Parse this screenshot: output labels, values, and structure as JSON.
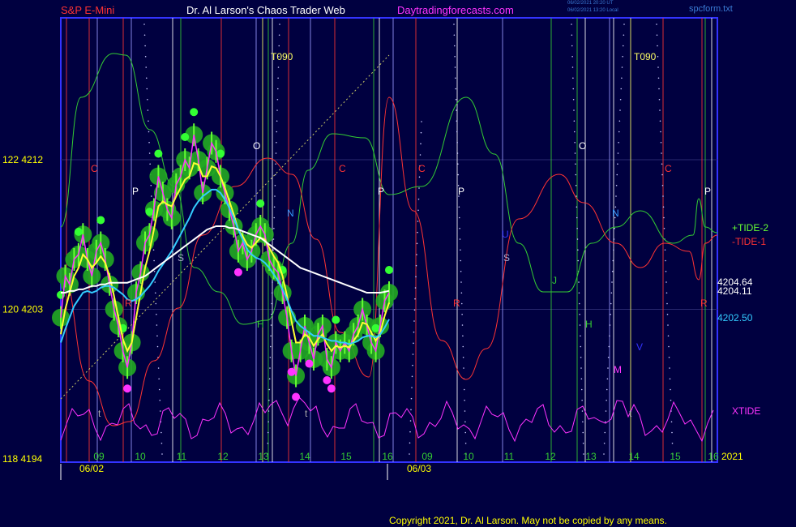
{
  "header": {
    "symbol": "S&P E-Mini",
    "site": "Dr. Al Larson's Chaos Trader Web",
    "url": "Daytradingforecasts.com",
    "stamp1": "06/02/2021 20:20 UT",
    "stamp2": "06/02/2021 13:20 Local",
    "file": "spcform.txt"
  },
  "footer": {
    "copyright": "Copyright 2021, Dr. Al Larson. May not be copied by any means."
  },
  "chart_data": {
    "type": "line",
    "y_left_labels": [
      "118 4194",
      "120 4203",
      "122 4212"
    ],
    "y_left_values": [
      4194,
      4203,
      4212
    ],
    "ylim": [
      4194,
      4212
    ],
    "hour_labels": [
      "09",
      "10",
      "11",
      "12",
      "13",
      "14",
      "15",
      "16",
      "09",
      "10",
      "11",
      "12",
      "13",
      "14",
      "15",
      "16"
    ],
    "date_labels": [
      "06/02",
      "06/03"
    ],
    "year_label": "2021",
    "right_labels": [
      {
        "text": "+TIDE-2",
        "color": "#66ff33"
      },
      {
        "text": "-TIDE-1",
        "color": "#ff3333"
      },
      {
        "text": "4204.64",
        "color": "#ffffff"
      },
      {
        "text": "4204.11",
        "color": "#ffffff"
      },
      {
        "text": "4202.50",
        "color": "#33ccff"
      },
      {
        "text": "XTIDE",
        "color": "#ff33ff"
      }
    ],
    "marker_letters": [
      {
        "text": "T090",
        "color": "#ffff66"
      },
      {
        "text": "T090",
        "color": "#ffff66"
      },
      {
        "text": "C",
        "color": "#ff3333"
      },
      {
        "text": "C",
        "color": "#ff3333"
      },
      {
        "text": "C",
        "color": "#ff3333"
      },
      {
        "text": "C",
        "color": "#ff3333"
      },
      {
        "text": "P",
        "color": "#ffffff"
      },
      {
        "text": "P",
        "color": "#ffffff"
      },
      {
        "text": "P",
        "color": "#ffffff"
      },
      {
        "text": "P",
        "color": "#ffffff"
      },
      {
        "text": "O",
        "color": "#ffffff"
      },
      {
        "text": "O",
        "color": "#ffffff"
      },
      {
        "text": "N",
        "color": "#3399ff"
      },
      {
        "text": "N",
        "color": "#3399ff"
      },
      {
        "text": "S",
        "color": "#aaaacc"
      },
      {
        "text": "S",
        "color": "#aaaacc"
      },
      {
        "text": "H",
        "color": "#33cc33"
      },
      {
        "text": "H",
        "color": "#33cc33"
      },
      {
        "text": "R",
        "color": "#ff3333"
      },
      {
        "text": "R",
        "color": "#ff3333"
      },
      {
        "text": "R",
        "color": "#ff3333"
      },
      {
        "text": "J",
        "color": "#33cc33"
      },
      {
        "text": "U",
        "color": "#3333ff"
      },
      {
        "text": "V",
        "color": "#3333ff"
      },
      {
        "text": "M",
        "color": "#ff33ff"
      },
      {
        "text": "t",
        "color": "#aaaaaa"
      },
      {
        "text": "t",
        "color": "#aaaaaa"
      },
      {
        "text": "t",
        "color": "#aaaaaa"
      }
    ],
    "series": [
      {
        "name": "",
        "color": "#ff33ff",
        "values": [
          4202.5,
          4205.0,
          4204.5,
          4206.0,
          4206.3,
          4207.5,
          4206.0,
          4205.0,
          4206.5,
          4207.0,
          4206.0,
          4204.5,
          4203.0,
          4202.0,
          4200.5,
          4199.5,
          4201.0,
          4204.0,
          4205.2,
          4207.0,
          4207.5,
          4209.0,
          4211.0,
          4210.0,
          4209.0,
          4208.5,
          4210.5,
          4211.0,
          4212.0,
          4211.5,
          4213.5,
          4212.0,
          4210.0,
          4211.5,
          4213.0,
          4212.5,
          4211.0,
          4210.0,
          4209.0,
          4208.0,
          4206.5,
          4207.0,
          4206.0,
          4206.5,
          4207.5,
          4208.0,
          4207.5,
          4206.0,
          4205.5,
          4205.2,
          4204.0,
          4202.5,
          4200.5,
          4199.0,
          4200.5,
          4202.0,
          4201.0,
          4200.0,
          4201.5,
          4202.0,
          4200.0,
          4199.5,
          4201.0,
          4200.5,
          4201.0,
          4200.5,
          4201.5,
          4202.0,
          4203.0,
          4202.0,
          4201.0,
          4200.5,
          4202.0,
          4203.5,
          4204.0
        ]
      },
      {
        "name": "",
        "color": "#ffff33",
        "values": [
          4201.5,
          4203.0,
          4204.0,
          4205.0,
          4205.5,
          4206.3,
          4206.0,
          4205.5,
          4205.8,
          4206.2,
          4205.8,
          4205.0,
          4203.8,
          4202.5,
          4201.2,
          4200.5,
          4201.0,
          4202.5,
          4204.0,
          4205.5,
          4206.5,
          4207.8,
          4209.2,
          4209.5,
          4209.3,
          4209.2,
          4209.8,
          4210.3,
          4210.8,
          4211.0,
          4211.8,
          4211.7,
          4211.0,
          4211.0,
          4211.6,
          4211.5,
          4211.0,
          4210.3,
          4209.5,
          4208.7,
          4207.8,
          4207.4,
          4206.9,
          4206.7,
          4207.0,
          4207.3,
          4207.2,
          4206.7,
          4206.2,
          4205.8,
          4205.0,
          4203.8,
          4202.3,
          4201.0,
          4201.0,
          4201.5,
          4201.3,
          4200.8,
          4201.2,
          4201.5,
          4200.9,
          4200.5,
          4200.8,
          4200.7,
          4200.8,
          4200.7,
          4201.1,
          4201.5,
          4202.2,
          4202.1,
          4201.6,
          4201.1,
          4201.6,
          4202.6,
          4203.4
        ]
      },
      {
        "name": "",
        "color": "#33ccff",
        "values": [
          4201.0,
          4201.8,
          4202.5,
          4203.2,
          4203.6,
          4204.0,
          4204.1,
          4204.0,
          4204.1,
          4204.3,
          4204.4,
          4204.4,
          4204.3,
          4204.1,
          4203.9,
          4203.6,
          4203.5,
          4203.6,
          4203.8,
          4204.1,
          4204.4,
          4204.8,
          4205.3,
          4205.7,
          4206.1,
          4206.5,
          4207.0,
          4207.5,
          4208.0,
          4208.5,
          4209.1,
          4209.5,
          4209.8,
          4210.0,
          4210.2,
          4210.2,
          4210.0,
          4209.6,
          4209.1,
          4208.5,
          4207.8,
          4207.2,
          4206.6,
          4206.3,
          4206.1,
          4206.0,
          4205.8,
          4205.5,
          4205.1,
          4204.7,
          4204.2,
          4203.6,
          4202.9,
          4202.3,
          4202.0,
          4201.8,
          4201.6,
          4201.4,
          4201.4,
          4201.3,
          4201.2,
          4201.1,
          4201.1,
          4201.0,
          4201.0,
          4200.9,
          4201.0,
          4201.1,
          4201.3,
          4201.4,
          4201.4,
          4201.3,
          4201.5,
          4201.9,
          4202.4
        ]
      },
      {
        "name": "",
        "color": "#ffffff",
        "values": [
          4204.0,
          4204.0,
          4204.1,
          4204.1,
          4204.2,
          4204.2,
          4204.3,
          4204.4,
          4204.4,
          4204.5,
          4204.5,
          4204.6,
          4204.6,
          4204.6,
          4204.6,
          4204.6,
          4204.7,
          4204.8,
          4204.9,
          4205.0,
          4205.2,
          4205.4,
          4205.6,
          4205.8,
          4206.0,
          4206.2,
          4206.4,
          4206.6,
          4206.8,
          4207.0,
          4207.2,
          4207.4,
          4207.6,
          4207.8,
          4207.9,
          4208.0,
          4208.0,
          4208.0,
          4207.9,
          4207.9,
          4207.8,
          4207.7,
          4207.6,
          4207.5,
          4207.4,
          4207.3,
          4207.1,
          4206.9,
          4206.7,
          4206.5,
          4206.3,
          4206.1,
          4205.9,
          4205.7,
          4205.5,
          4205.4,
          4205.3,
          4205.2,
          4205.1,
          4205.0,
          4204.9,
          4204.8,
          4204.7,
          4204.6,
          4204.5,
          4204.4,
          4204.3,
          4204.2,
          4204.1,
          4204.0,
          4204.0,
          4204.0,
          4204.0,
          4204.05,
          4204.11
        ]
      }
    ]
  }
}
